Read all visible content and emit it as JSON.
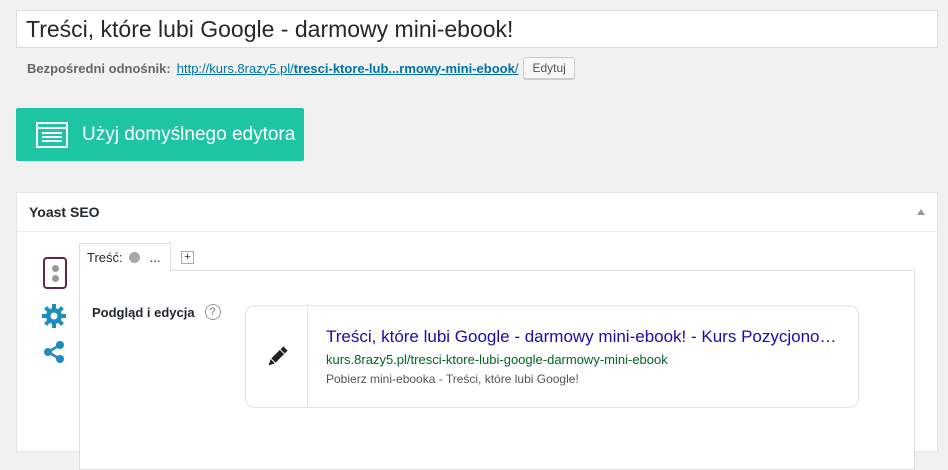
{
  "post": {
    "title": "Treści, które lubi Google - darmowy mini-ebook!",
    "permalink_label": "Bezpośredni odnośnik:",
    "permalink_prefix": "http://kurs.8razy5.pl/",
    "permalink_slug": "tresci-ktore-lub...rmowy-mini-ebook",
    "permalink_suffix": "/",
    "edit_label": "Edytuj"
  },
  "editor": {
    "default_editor_label": "Użyj domyślnego edytora",
    "accent_color": "#1ec5a5"
  },
  "yoast": {
    "panel_title": "Yoast SEO",
    "side_icons": [
      "traffic-light-icon",
      "gear-icon",
      "share-icon"
    ],
    "tab_label": "Treść:",
    "tab_extra": "...",
    "add_tab_label": "+",
    "preview_label": "Podgląd i edycja",
    "help_label": "?",
    "snippet": {
      "title": "Treści, które lubi Google - darmowy mini-ebook! - Kurs Pozycjonowania",
      "url": "kurs.8razy5.pl/tresci-ktore-lubi-google-darmowy-mini-ebook",
      "description": "Pobierz mini-ebooka - Treści, które lubi Google!"
    }
  }
}
